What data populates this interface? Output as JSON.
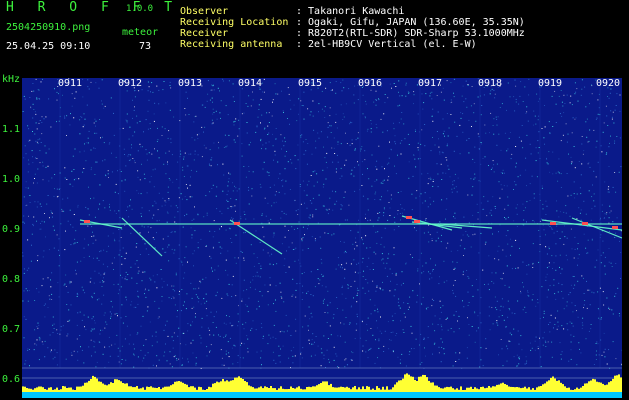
{
  "header": {
    "app_title": "H R O F F T",
    "version": "1.0.0",
    "filename": "2504250910.png",
    "datetime": "25.04.25 09:10",
    "meteor_label": "meteor",
    "meteor_count": "73",
    "info": [
      {
        "label": "Observer",
        "value": ": Takanori Kawachi"
      },
      {
        "label": "Receiving Location",
        "value": ": Ogaki, Gifu, JAPAN (136.60E, 35.35N)"
      },
      {
        "label": "Receiver",
        "value": ": R820T2(RTL-SDR) SDR-Sharp 53.1000MHz"
      },
      {
        "label": "Receiving antenna",
        "value": ": 2el-HB9CV Vertical (el. E-W)"
      }
    ]
  },
  "yaxis": {
    "unit": "kHz",
    "ticks": [
      "1.1",
      "1.0",
      "0.9",
      "0.8",
      "0.7",
      "0.6"
    ]
  },
  "xaxis": {
    "ticks": [
      "0911",
      "0912",
      "0913",
      "0914",
      "0915",
      "0916",
      "0917",
      "0918",
      "0919",
      "0920"
    ]
  },
  "colors": {
    "background": "#0a1a8a",
    "noise_cyan": "#3ac8e0",
    "trace": "#66ffcc",
    "meteor_hot": "#ff5050",
    "bars": "#ffff33",
    "bar_base": "#00c8ff"
  }
}
